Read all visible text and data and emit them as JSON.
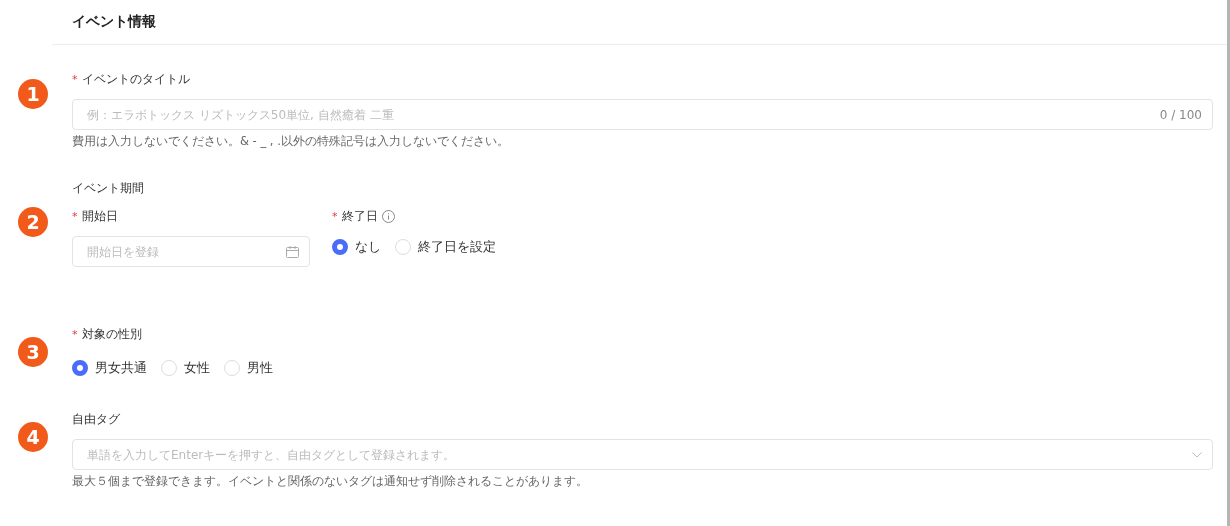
{
  "header": {
    "title": "イベント情報"
  },
  "sections": [
    {
      "kind": "text",
      "step": "1",
      "label": "イベントのタイトル",
      "mark": "*",
      "placeholder": "例：エラボトックス リズトックス50単位, 自然癒着 二重",
      "counter": "0 / 100",
      "help": "費用は入力しないでください。& - _ , .以外の特殊記号は入力しないでください。"
    },
    {
      "kind": "period",
      "step": "2",
      "label": "イベント期間",
      "start": {
        "label": "開始日",
        "mark": "*",
        "placeholder": "開始日を登録"
      },
      "end": {
        "label": "終了日",
        "mark": "*",
        "options": [
          {
            "label": "なし",
            "selected": true
          },
          {
            "label": "終了日を設定",
            "selected": false
          }
        ]
      }
    },
    {
      "kind": "radio",
      "step": "3",
      "label": "対象の性別",
      "mark": "*",
      "options": [
        {
          "label": "男女共通",
          "selected": true
        },
        {
          "label": "女性",
          "selected": false
        },
        {
          "label": "男性",
          "selected": false
        }
      ]
    },
    {
      "kind": "tags",
      "step": "4",
      "label": "自由タグ",
      "placeholder": "単語を入力してEnterキーを押すと、自由タグとして登録されます。",
      "help": "最大５個まで登録できます。イベントと関係のないタグは通知せず削除されることがあります。"
    }
  ]
}
